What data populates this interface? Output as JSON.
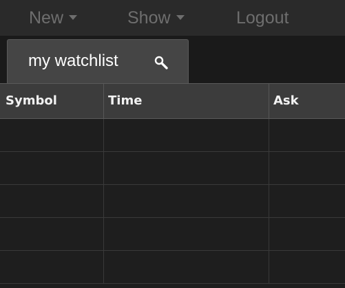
{
  "menu": {
    "new_label": "New",
    "show_label": "Show",
    "logout_label": "Logout"
  },
  "tabs": [
    {
      "label": "my watchlist",
      "icon": "search-icon",
      "active": true
    }
  ],
  "grid": {
    "columns": [
      "Symbol",
      "Time",
      "Ask"
    ],
    "rows": [
      {
        "symbol": "",
        "time": "",
        "ask": ""
      },
      {
        "symbol": "",
        "time": "",
        "ask": ""
      },
      {
        "symbol": "",
        "time": "",
        "ask": ""
      },
      {
        "symbol": "",
        "time": "",
        "ask": ""
      },
      {
        "symbol": "",
        "time": "",
        "ask": ""
      }
    ]
  },
  "colors": {
    "background": "#1e1e1e",
    "menu_text": "#6e6e6e",
    "active_tab": "#454545",
    "header_bg": "#3c3c3c",
    "header_text": "#f2f2f2",
    "grid_lines": "#3a3a3a"
  }
}
